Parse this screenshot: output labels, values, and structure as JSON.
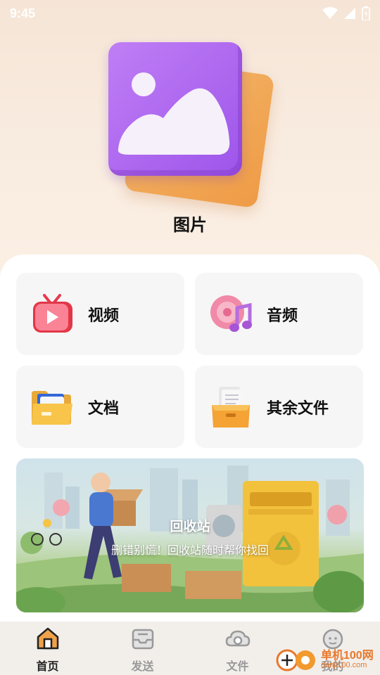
{
  "status_bar": {
    "time": "9:45"
  },
  "hero": {
    "title": "图片"
  },
  "categories": [
    {
      "label": "视频",
      "icon": "tv-video-icon"
    },
    {
      "label": "音频",
      "icon": "music-disc-icon"
    },
    {
      "label": "文档",
      "icon": "folder-docs-icon"
    },
    {
      "label": "其余文件",
      "icon": "file-box-icon"
    }
  ],
  "banner": {
    "title": "回收站",
    "subtitle": "删错别慌！回收站随时帮你找回"
  },
  "bottom_nav": [
    {
      "label": "首页",
      "icon": "home-icon",
      "active": true
    },
    {
      "label": "发送",
      "icon": "inbox-tray-icon",
      "active": false
    },
    {
      "label": "文件",
      "icon": "cloud-icon",
      "active": false
    },
    {
      "label": "我的",
      "icon": "profile-face-icon",
      "active": false
    }
  ],
  "watermark": {
    "text": "单机100网",
    "sub": "danji100.com"
  },
  "colors": {
    "accent_purple": "#a35bec",
    "accent_orange": "#ef9b46",
    "nav_active": "#222222",
    "nav_inactive": "#999999"
  }
}
